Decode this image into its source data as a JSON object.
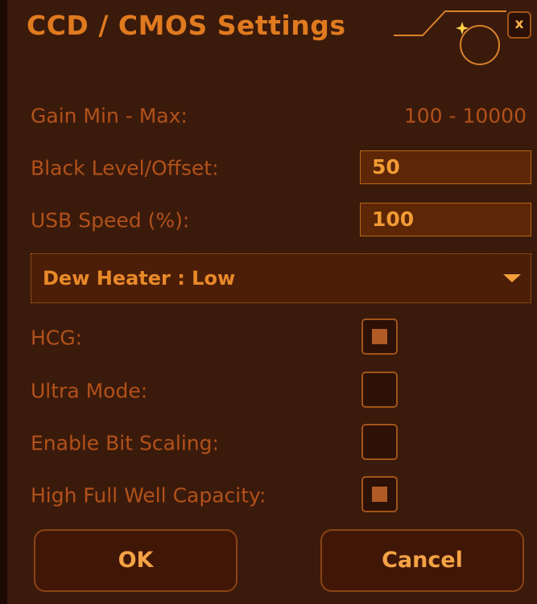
{
  "window": {
    "title": "CCD / CMOS Settings",
    "close_label": "x"
  },
  "gain": {
    "label": "Gain Min - Max:",
    "value": "100 - 10000"
  },
  "black_level": {
    "label": "Black Level/Offset:",
    "value": "50"
  },
  "usb_speed": {
    "label": "USB Speed (%):",
    "value": "100"
  },
  "dew_heater": {
    "selected": "Dew Heater : Low"
  },
  "checkboxes": [
    {
      "label": "HCG:",
      "checked": true
    },
    {
      "label": "Ultra Mode:",
      "checked": false
    },
    {
      "label": "Enable Bit Scaling:",
      "checked": false
    },
    {
      "label": "High Full Well Capacity:",
      "checked": true
    }
  ],
  "buttons": {
    "ok": "OK",
    "cancel": "Cancel"
  },
  "colors": {
    "background": "#3a1a0b",
    "label": "#b2511a",
    "accent": "#e07a1f",
    "input_bg": "#5c2607"
  },
  "icons": {
    "title_decoration": "curve-circle-sparkle-icon",
    "dropdown": "chevron-down-icon"
  }
}
